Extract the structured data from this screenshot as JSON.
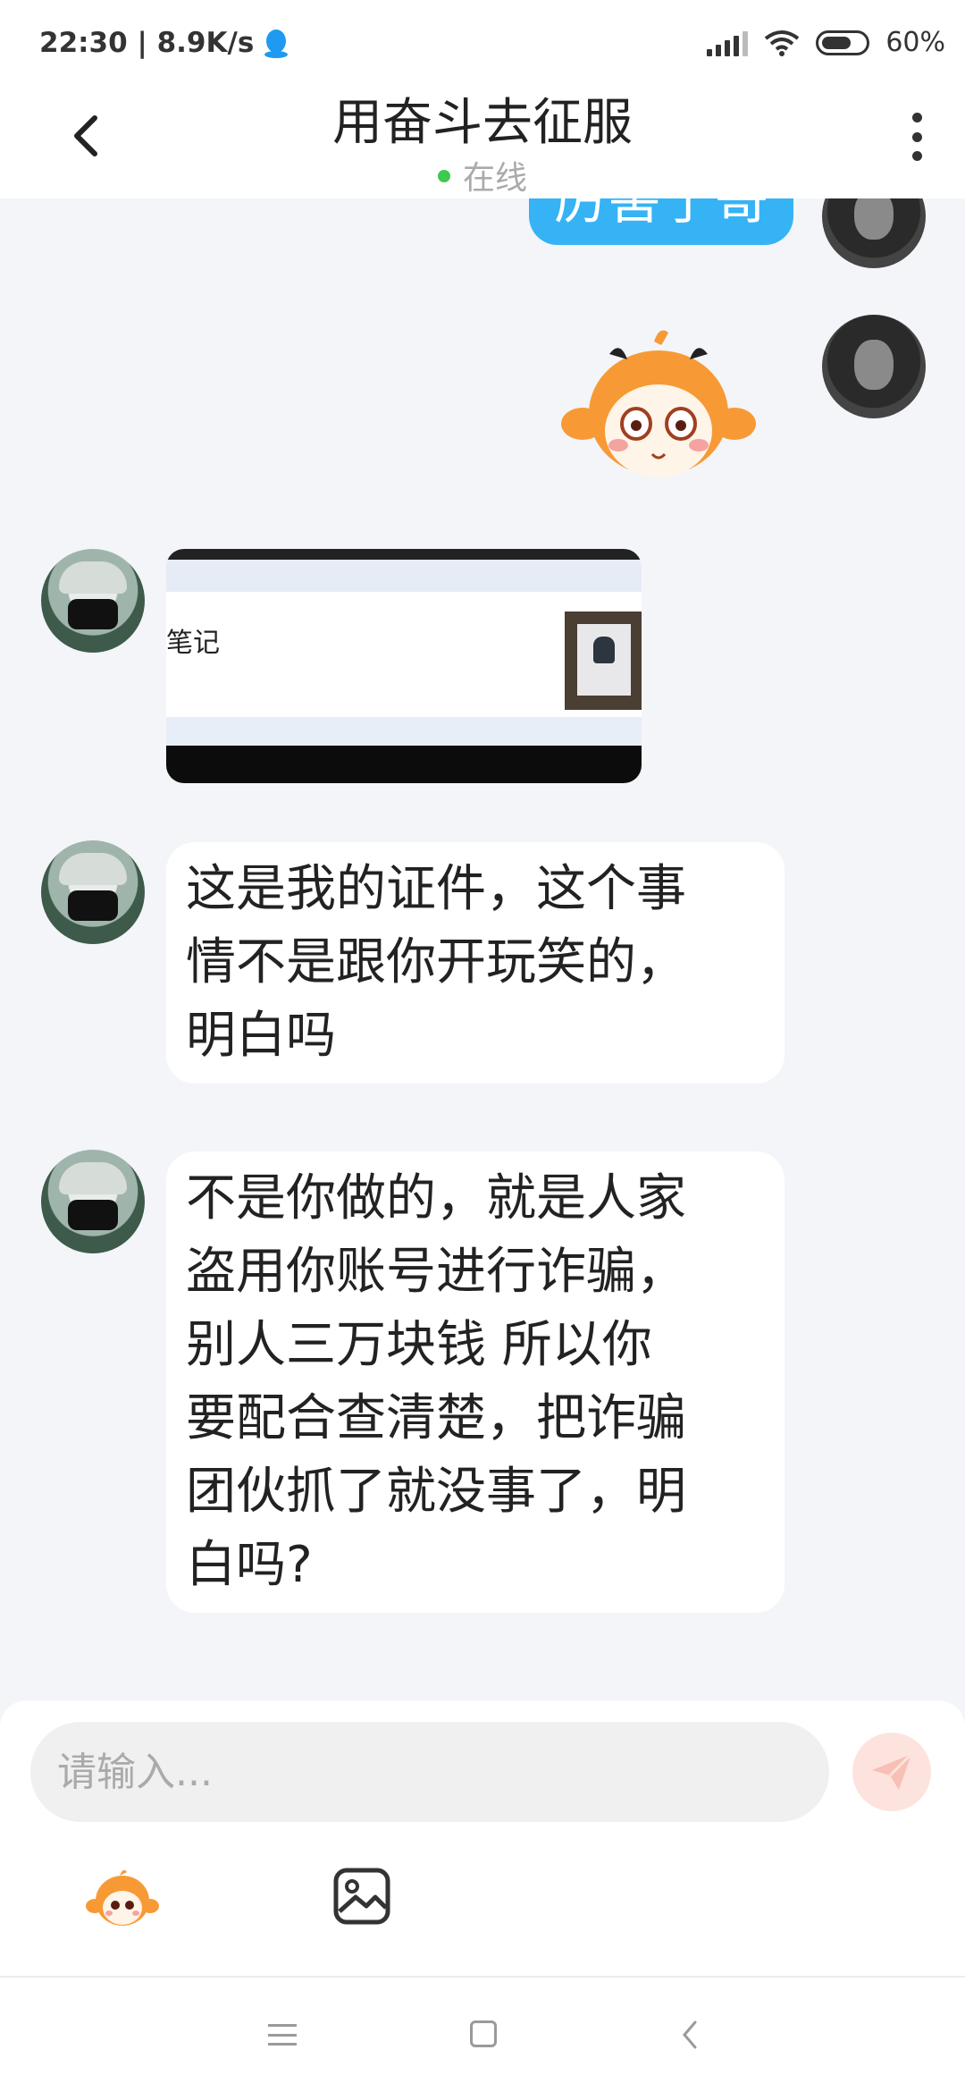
{
  "status_bar": {
    "time_speed": "22:30 | 8.9K/s",
    "battery": "60%"
  },
  "header": {
    "title": "用奋斗去征服",
    "status": "在线"
  },
  "messages": {
    "m1": "厉害了哥",
    "image_msg_label": "笔记",
    "m2": [
      "这是我的证件，这个事",
      "情不是跟你开玩笑的，",
      "明白吗"
    ],
    "m3": [
      "不是你做的，就是人家",
      "盗用你账号进行诈骗，",
      "别人三万块钱 所以你",
      "要配合查清楚，把诈骗",
      "团伙抓了就没事了，明",
      "白吗?"
    ]
  },
  "input": {
    "placeholder": "请输入..."
  },
  "icons": {
    "back": "back-arrow-icon",
    "more": "more-vertical-icon",
    "send": "send-icon",
    "emoji": "emoji-sticker-icon",
    "image": "image-picker-icon",
    "qq": "qq-penguin-icon"
  },
  "colors": {
    "outgoing_bubble": "#35b3f5",
    "online_dot": "#3dca4f",
    "background": "#f3f5f9"
  }
}
